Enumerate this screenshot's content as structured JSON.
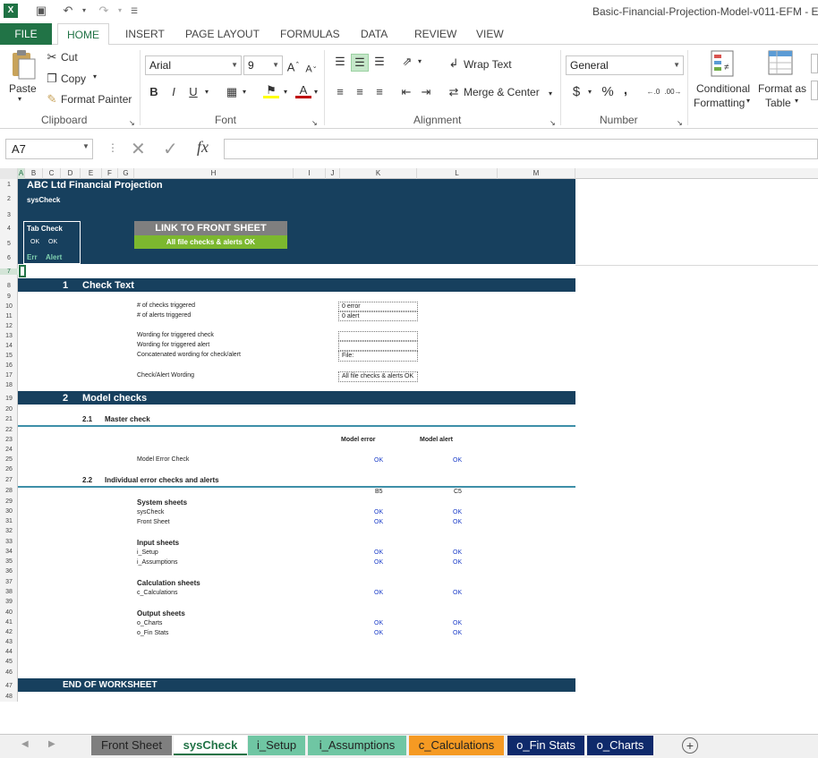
{
  "app": {
    "title": "Basic-Financial-Projection-Model-v011-EFM - E"
  },
  "ribbon_tabs": [
    "FILE",
    "HOME",
    "INSERT",
    "PAGE LAYOUT",
    "FORMULAS",
    "DATA",
    "REVIEW",
    "VIEW"
  ],
  "clipboard": {
    "paste": "Paste",
    "cut": "Cut",
    "copy": "Copy",
    "format_painter": "Format Painter",
    "label": "Clipboard"
  },
  "font": {
    "name": "Arial",
    "size": "9",
    "bold": "B",
    "italic": "I",
    "underline": "U",
    "label": "Font"
  },
  "alignment": {
    "wrap_text": "Wrap Text",
    "merge_center": "Merge & Center",
    "label": "Alignment"
  },
  "number": {
    "format": "General",
    "currency": "$",
    "percent": "%",
    "comma": ",",
    "label": "Number"
  },
  "styles": {
    "conditional_formatting_1": "Conditional",
    "conditional_formatting_2": "Formatting",
    "format_as_table_1": "Format as",
    "format_as_table_2": "Table"
  },
  "formula_bar": {
    "name_box": "A7",
    "fx": "fx"
  },
  "columns": [
    "A",
    "B",
    "C",
    "D",
    "E",
    "F",
    "G",
    "H",
    "I",
    "J",
    "K",
    "L",
    "M"
  ],
  "rows": [
    "1",
    "2",
    "3",
    "4",
    "5",
    "6",
    "7",
    "8",
    "9",
    "10",
    "11",
    "12",
    "13",
    "14",
    "15",
    "16",
    "17",
    "18",
    "19",
    "20",
    "21",
    "22",
    "23",
    "24",
    "25",
    "26",
    "27",
    "28",
    "29",
    "30",
    "31",
    "32",
    "33",
    "34",
    "35",
    "36",
    "37",
    "38",
    "39",
    "40",
    "41",
    "42",
    "43",
    "44",
    "45",
    "46",
    "47",
    "48"
  ],
  "sheet": {
    "title": "ABC Ltd Financial Projection",
    "subtitle": "sysCheck",
    "tab_check": "Tab Check",
    "ok1": "OK",
    "ok2": "OK",
    "err": "Err",
    "alert": "Alert",
    "link_btn": "LINK TO FRONT SHEET",
    "link_status": "All file checks & alerts OK",
    "sec1_num": "1",
    "sec1_title": "Check Text",
    "checks_triggered_label": "# of checks triggered",
    "checks_triggered_val": "0 error",
    "alerts_triggered_label": "# of alerts triggered",
    "alerts_triggered_val": "0 alert",
    "wording_check": "Wording for triggered check",
    "wording_alert": "Wording for triggered alert",
    "concat_wording": "Concatenated wording for check/alert",
    "concat_val": "File:",
    "check_alert_wording": "Check/Alert Wording",
    "check_alert_val": "All file checks & alerts OK",
    "sec2_num": "2",
    "sec2_title": "Model checks",
    "sub21_num": "2.1",
    "sub21_title": "Master check",
    "model_error_hdr": "Model error",
    "model_alert_hdr": "Model alert",
    "model_error_check": "Model Error Check",
    "mec_err": "OK",
    "mec_alert": "OK",
    "sub22_num": "2.2",
    "sub22_title": "Individual error checks and alerts",
    "ref_k": "B5",
    "ref_l": "C5",
    "groups": [
      {
        "title": "System sheets",
        "items": [
          {
            "name": "sysCheck",
            "err": "OK",
            "alert": "OK"
          },
          {
            "name": "Front Sheet",
            "err": "OK",
            "alert": "OK"
          }
        ]
      },
      {
        "title": "Input sheets",
        "items": [
          {
            "name": "i_Setup",
            "err": "OK",
            "alert": "OK"
          },
          {
            "name": "i_Assumptions",
            "err": "OK",
            "alert": "OK"
          }
        ]
      },
      {
        "title": "Calculation sheets",
        "items": [
          {
            "name": "c_Calculations",
            "err": "OK",
            "alert": "OK"
          }
        ]
      },
      {
        "title": "Output sheets",
        "items": [
          {
            "name": "o_Charts",
            "err": "OK",
            "alert": "OK"
          },
          {
            "name": "o_Fin Stats",
            "err": "OK",
            "alert": "OK"
          }
        ]
      }
    ],
    "end": "END OF WORKSHEET"
  },
  "sheet_tabs": [
    {
      "label": "Front Sheet",
      "color": "#7f7f7f"
    },
    {
      "label": "sysCheck",
      "color": "#ffffff"
    },
    {
      "label": "i_Setup",
      "color": "#6fc6a3"
    },
    {
      "label": "i_Assumptions",
      "color": "#6fc6a3"
    },
    {
      "label": "c_Calculations",
      "color": "#f59a23"
    },
    {
      "label": "o_Fin Stats",
      "color": "#0f2a6b"
    },
    {
      "label": "o_Charts",
      "color": "#0f2a6b"
    }
  ]
}
